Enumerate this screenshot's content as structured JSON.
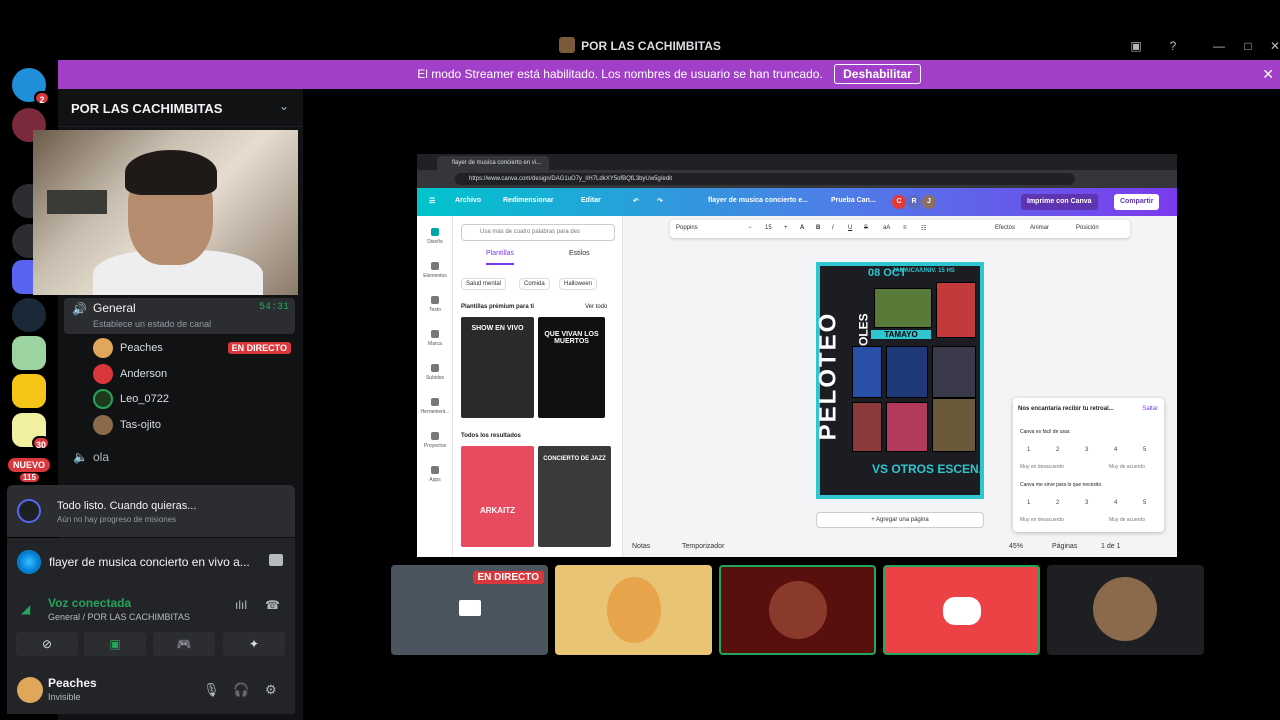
{
  "window": {
    "title": "POR LAS CACHIMBITAS"
  },
  "banner": {
    "text": "El modo Streamer está habilitado. Los nombres de usuario se han truncado.",
    "button": "Deshabilitar"
  },
  "rail": {
    "badges": [
      "2",
      "30",
      "115"
    ],
    "new_label": "NUEVO"
  },
  "server": {
    "name": "POR LAS CACHIMBITAS"
  },
  "voice_channel": {
    "name": "General",
    "timer": "54:31",
    "status_placeholder": "Establece un estado de canal",
    "members": [
      {
        "name": "Peaches",
        "live": "EN DIRECTO",
        "color": "#e0a65a"
      },
      {
        "name": "Anderson",
        "live": "",
        "color": "#da373c"
      },
      {
        "name": "Leo_0722",
        "live": "",
        "color": "#1e3a1e"
      },
      {
        "name": "Tas-ojito",
        "live": "",
        "color": "#8a6a4a"
      }
    ]
  },
  "other_channel": {
    "name": "ola"
  },
  "quest": {
    "title": "Todo listo. Cuando quieras...",
    "subtitle": "Aún no hay progreso de misiones"
  },
  "activity": {
    "title": "flayer de musica concierto en vivo a..."
  },
  "voice_status": {
    "title": "Voz conectada",
    "subtitle": "General / POR LAS CACHIMBITAS"
  },
  "user": {
    "name": "Peaches",
    "status": "Invisible"
  },
  "stream": {
    "tab_title": "flayer de musica concierto en vi...",
    "url": "https://www.canva.com/design/DAG1uO7y_l/H7LdkXY5ofBQfL3byUw5g/edit",
    "menu": {
      "file": "Archivo",
      "resize": "Redimensionar",
      "edit": "Editar",
      "doc_title": "flayer de musica concierto e...",
      "trial": "Prueba Can...",
      "print": "Imprime con Canva",
      "share": "Compartir",
      "avatars": [
        "C",
        "R",
        "J"
      ]
    },
    "side_nav": [
      "Diseño",
      "Elementos",
      "Texto",
      "Marca",
      "Subidos",
      "Herramient...",
      "Proyectos",
      "Apps"
    ],
    "search_placeholder": "Usa más de cuatro palabras para des",
    "tabs": [
      "Plantillas",
      "Estilos"
    ],
    "chips": [
      "Salud mental",
      "Comida",
      "Halloween"
    ],
    "premium_heading": "Plantillas prémium para ti",
    "see_all": "Ver todo",
    "all_results": "Todos los resultados",
    "thumbs": [
      "SHOW EN VIVO",
      "QUE VIVAN LOS MUERTOS",
      "ARKAITZ",
      "CONCIERTO DE JAZZ"
    ],
    "toolbar": {
      "font": "Poppins",
      "size": "15",
      "effects": "Efectos",
      "animate": "Animar",
      "position": "Posición"
    },
    "poster": {
      "date": "08 OCT",
      "venue": "JAMAICA/UNIV. 15 HS",
      "day": "MIERCOLES",
      "main": "PELOTEO",
      "name": "TAMAYO",
      "bottom": "VS OTROS ESCENARIOS"
    },
    "add_page": "+ Agregar una página",
    "survey": {
      "heading": "Nos encantaría recibir tu retroal...",
      "skip": "Saltar",
      "q1": "Canva es fácil de usar.",
      "q2": "Canva me sirve para lo que necesito.",
      "scale": [
        "1",
        "2",
        "3",
        "4",
        "5"
      ],
      "low": "Muy en desacuerdo",
      "high": "Muy de acuerdo"
    },
    "bottom": {
      "notes": "Notas",
      "timer": "Temporizador",
      "zoom": "45%",
      "pages": "Páginas",
      "page_count": "1 de 1"
    }
  },
  "tiles": {
    "live_label": "EN DIRECTO"
  }
}
